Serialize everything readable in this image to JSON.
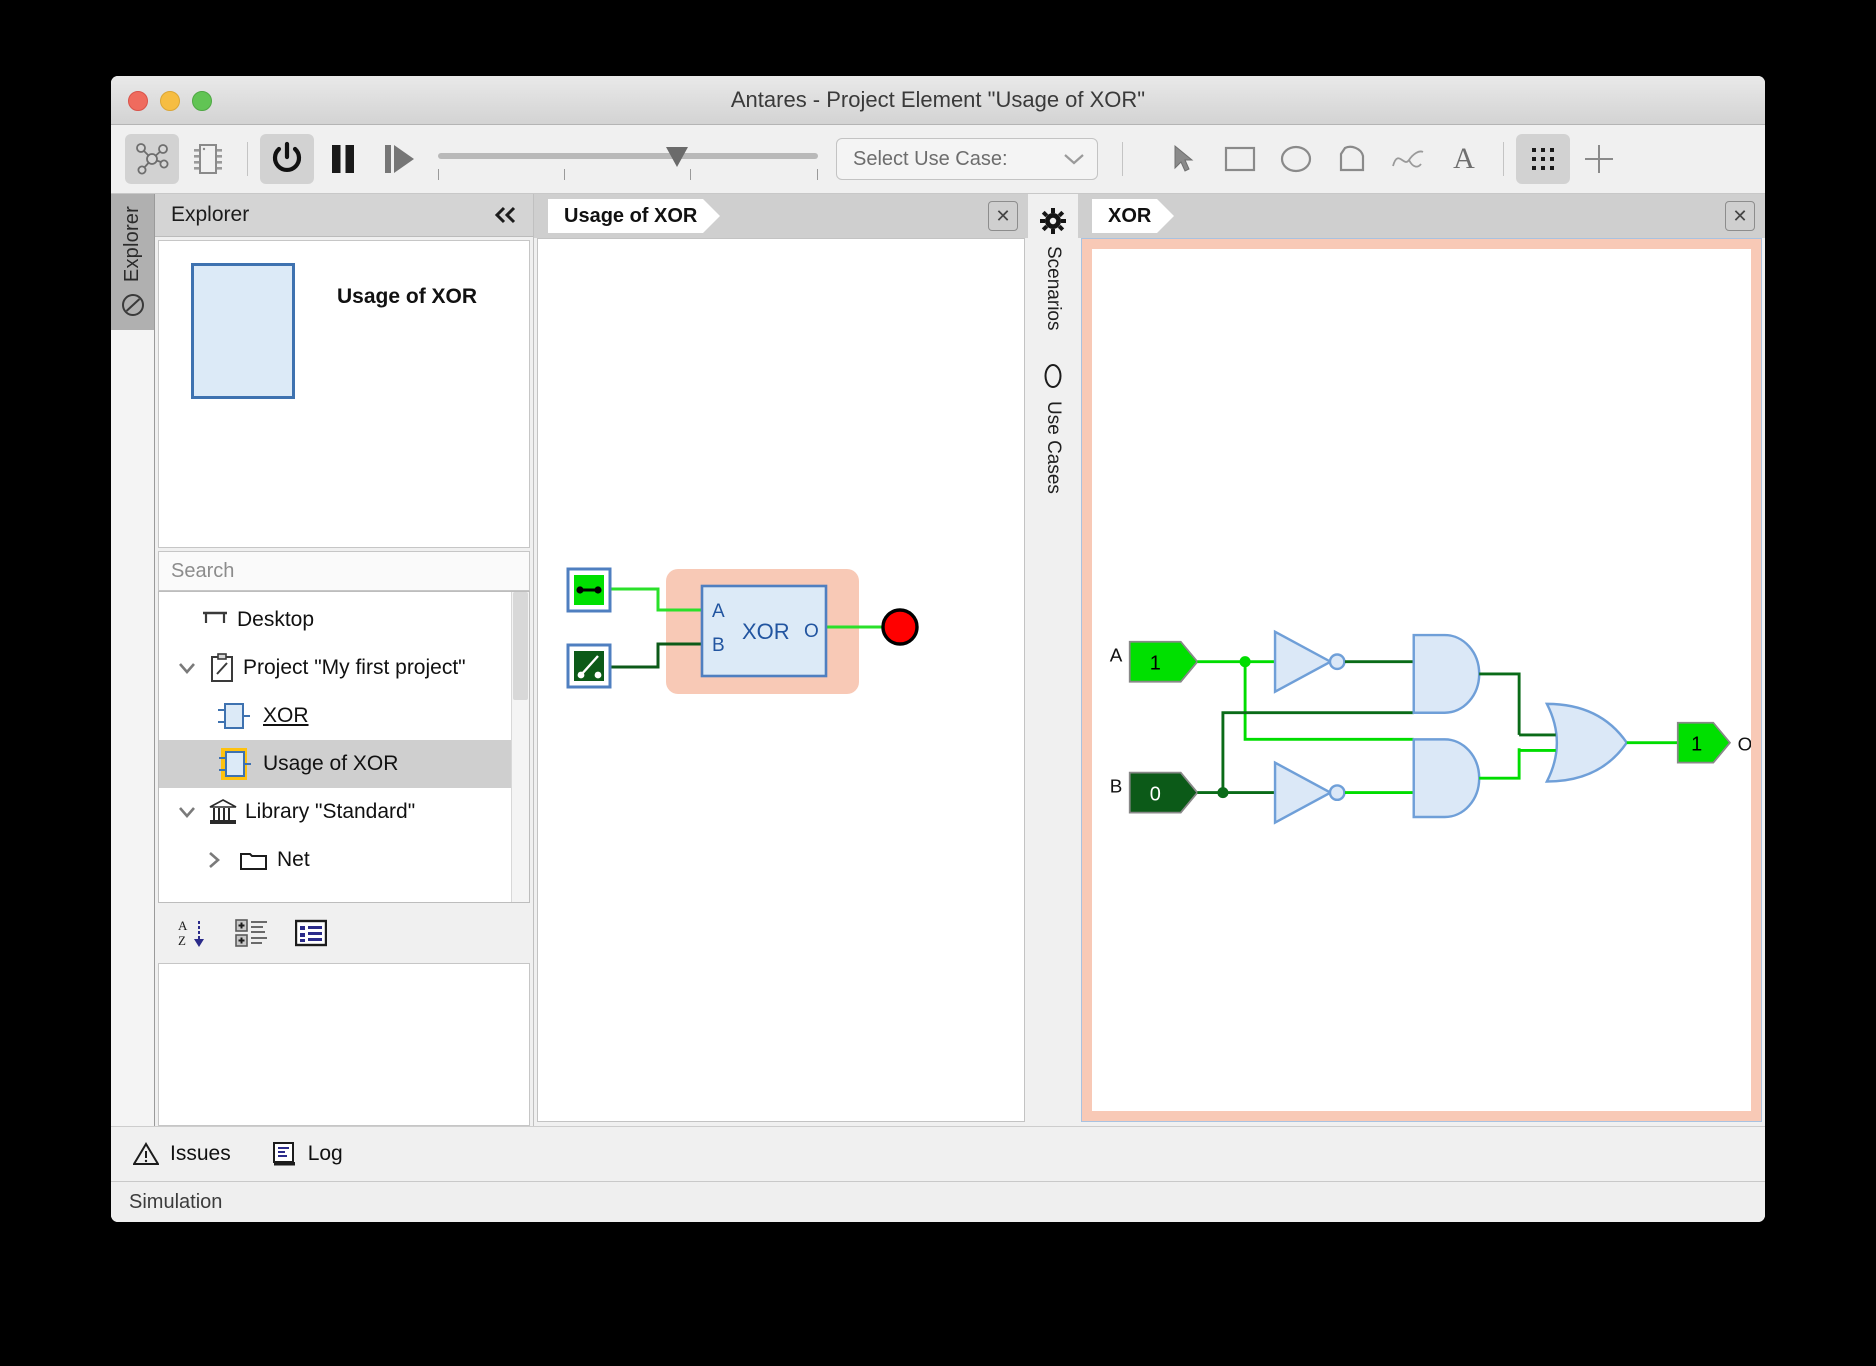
{
  "window": {
    "title": "Antares - Project Element \"Usage of XOR\"",
    "traffic": {
      "close": "close-button",
      "minimize": "minimize-button",
      "zoom": "zoom-button"
    }
  },
  "toolbar": {
    "icons": [
      {
        "name": "network-graph-icon",
        "active": true
      },
      {
        "name": "chip-icon",
        "active": false
      },
      {
        "name": "power-icon",
        "active": true
      },
      {
        "name": "pause-icon",
        "active": false
      },
      {
        "name": "step-icon",
        "active": false
      }
    ],
    "slider": {
      "value_pos_pct": 60,
      "ticks": [
        0,
        33,
        66,
        100
      ]
    },
    "use_case_select": {
      "label": "Select Use Case:",
      "chevron": "chevron-down-icon"
    },
    "draw_tools": [
      {
        "name": "pointer-tool",
        "glyph": "arrow"
      },
      {
        "name": "rectangle-tool",
        "glyph": "rect"
      },
      {
        "name": "ellipse-tool",
        "glyph": "ellipse"
      },
      {
        "name": "polygon-tool",
        "glyph": "poly"
      },
      {
        "name": "curve-tool",
        "glyph": "curve"
      },
      {
        "name": "text-tool",
        "glyph": "A"
      },
      {
        "name": "grid-tool",
        "glyph": "grid",
        "active": true
      },
      {
        "name": "crosshair-tool",
        "glyph": "cross"
      }
    ]
  },
  "rail": {
    "label": "Explorer",
    "icon": "no-entry-icon"
  },
  "explorer": {
    "header": "Explorer",
    "collapse_icon": "double-chevron-left-icon",
    "preview_title": "Usage of XOR",
    "search_placeholder": "Search",
    "tree": [
      {
        "label": "Desktop",
        "icon": "desktop-icon",
        "indent": 0,
        "chevron": "",
        "selected": false,
        "underline": false
      },
      {
        "label": "Project \"My first project\"",
        "icon": "clipboard-icon",
        "indent": 1,
        "chevron": "v",
        "selected": false,
        "underline": false
      },
      {
        "label": "XOR",
        "icon": "block-icon",
        "indent": 2,
        "chevron": "",
        "selected": false,
        "underline": true
      },
      {
        "label": "Usage of XOR",
        "icon": "block-icon-highlighted",
        "indent": 2,
        "chevron": "",
        "selected": true,
        "underline": false
      },
      {
        "label": "Library \"Standard\"",
        "icon": "library-icon",
        "indent": 1,
        "chevron": "v",
        "selected": false,
        "underline": false
      },
      {
        "label": "Net",
        "icon": "folder-icon",
        "indent": 2,
        "chevron": ">",
        "selected": false,
        "underline": false
      }
    ],
    "tools": [
      {
        "name": "sort-az-button",
        "glyph": "AZ"
      },
      {
        "name": "expand-all-button",
        "glyph": "expand"
      },
      {
        "name": "list-view-button",
        "glyph": "list"
      }
    ]
  },
  "center_panel": {
    "tab_label": "Usage of XOR",
    "close_icon": "close-icon",
    "diagram": {
      "switch_closed": {
        "name": "switch-closed",
        "state": "closed",
        "color": "#00e000"
      },
      "switch_open": {
        "name": "switch-open",
        "state": "open",
        "color": "#0c5a18"
      },
      "block": {
        "label": "XOR",
        "input_a": "A",
        "input_b": "B",
        "output": "O"
      },
      "led": {
        "name": "led-indicator",
        "color": "#ff0000"
      },
      "group_color": "#f8c9b6"
    }
  },
  "scenario_rail": {
    "items": [
      {
        "label": "Scenarios",
        "icon": "gear-icon"
      },
      {
        "label": "Use Cases",
        "icon": "oval-icon"
      }
    ]
  },
  "right_panel": {
    "tab_label": "XOR",
    "close_icon": "close-icon",
    "circuit": {
      "inputs": [
        {
          "name": "A",
          "value": "1",
          "active": true
        },
        {
          "name": "B",
          "value": "0",
          "active": false
        }
      ],
      "outputs": [
        {
          "name": "O",
          "value": "1",
          "active": true
        }
      ],
      "gates": [
        {
          "type": "not",
          "id": "not-a"
        },
        {
          "type": "not",
          "id": "not-b"
        },
        {
          "type": "and",
          "id": "and-top"
        },
        {
          "type": "and",
          "id": "and-bottom"
        },
        {
          "type": "or",
          "id": "or-out"
        }
      ],
      "wire_on_color": "#00dd00",
      "wire_off_color": "#0a6b18",
      "gate_fill": "#dbe8f7",
      "gate_stroke": "#6f9fd8"
    }
  },
  "bottom": {
    "items": [
      {
        "label": "Issues",
        "icon": "warning-triangle-icon"
      },
      {
        "label": "Log",
        "icon": "log-document-icon"
      }
    ],
    "status": "Simulation"
  }
}
